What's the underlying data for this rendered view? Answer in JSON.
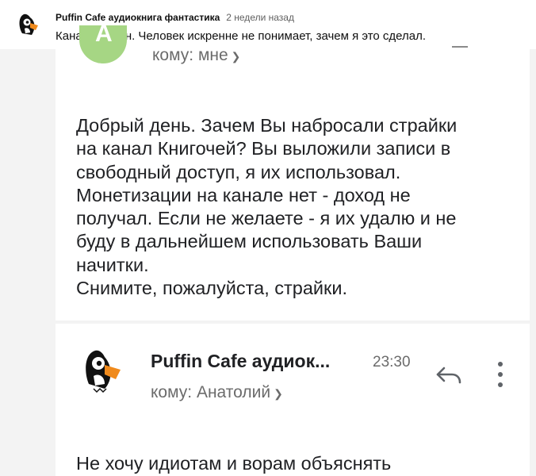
{
  "post": {
    "author": "Puffin Cafe аудиокнига фантастика",
    "time": "2 недели назад",
    "text": "Канал удален. Человек искренне не понимает, зачем я это сделал."
  },
  "email1": {
    "avatar_letter": "А",
    "to": "кому: мне",
    "body": "Добрый день. Зачем Вы набросали страйки\nна канал Книгочей? Вы выложили записи в\nсвободный доступ, я их использовал.\nМонетизации на канале нет - доход не\nполучал. Если не желаете - я их удалю и не\nбуду в дальнейшем использовать Ваши\nначитки.\nСнимите, пожалуйста, страйки."
  },
  "email2": {
    "sender": "Puffin Cafe аудиок...",
    "time": "23:30",
    "to": "кому: Анатолий",
    "body": "Не хочу идиотам и ворам объяснять"
  },
  "icons": {
    "chevron": "chevron-down-icon",
    "reply": "reply-icon",
    "more": "more-vert-icon"
  }
}
